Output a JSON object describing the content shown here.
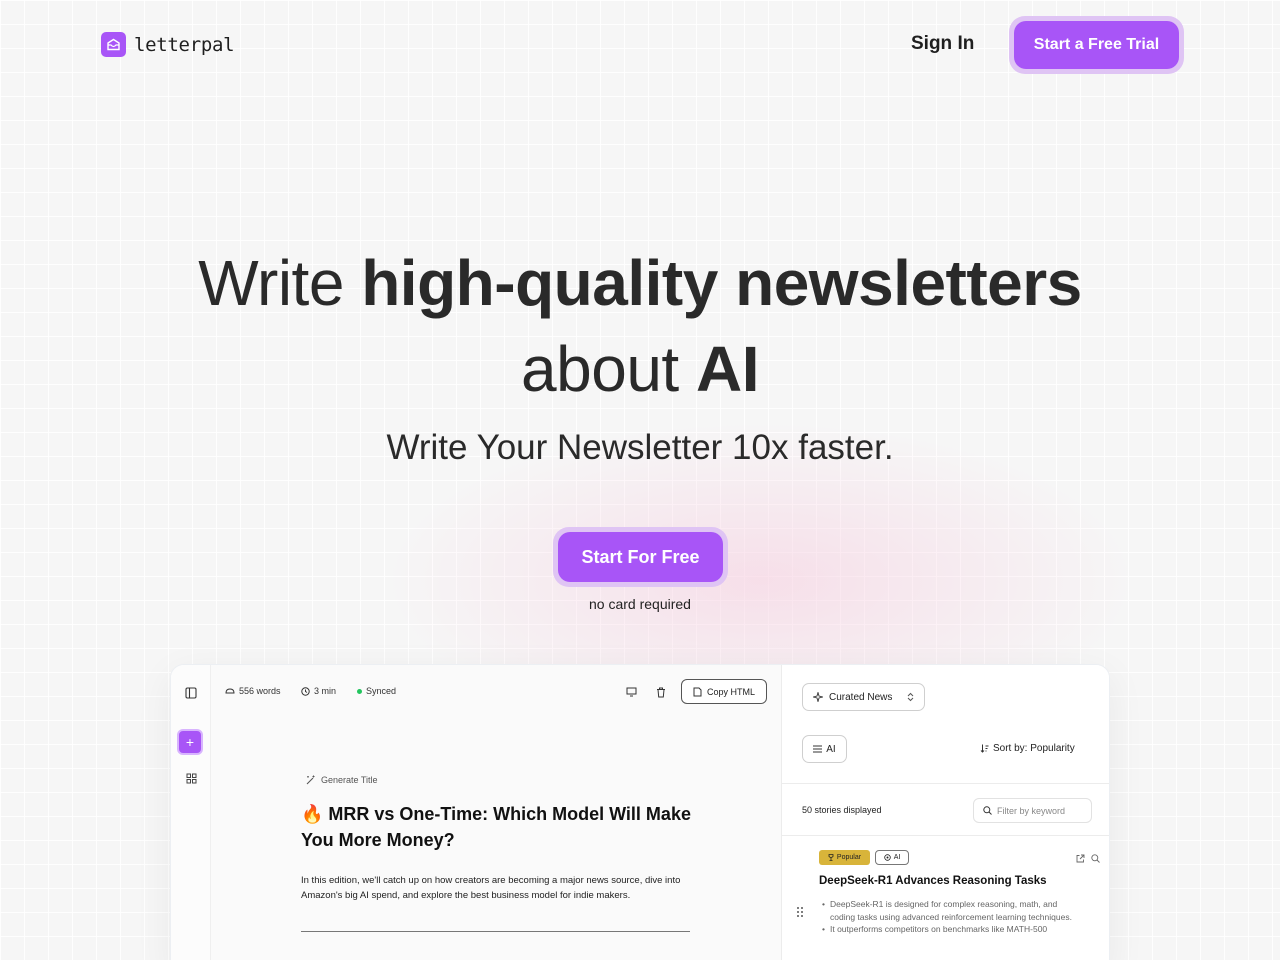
{
  "brand": {
    "name": "letterpal"
  },
  "nav": {
    "sign_in": "Sign In",
    "cta": "Start a Free Trial"
  },
  "hero": {
    "title_1": "Write ",
    "title_2": "high-quality newsletters",
    "title_3": "about ",
    "title_4": "AI",
    "subtitle": "Write Your Newsletter 10x faster.",
    "cta": "Start For Free",
    "note": "no card required"
  },
  "editor": {
    "words": "556 words",
    "read_time": "3 min",
    "sync_status": "Synced",
    "copy_html": "Copy HTML",
    "generate_title": "Generate Title",
    "doc_title": "🔥 MRR vs One-Time: Which Model Will Make You More Money?",
    "intro": "In this edition, we'll catch up on how creators are becoming a major news source, dive into Amazon's big AI spend, and explore the best business model for indie makers."
  },
  "panel": {
    "source": "Curated News",
    "tag": "AI",
    "sort": "Sort by: Popularity",
    "count": "50 stories displayed",
    "filter_placeholder": "Filter by keyword",
    "story": {
      "badge_popular": "Popular",
      "badge_ai": "AI",
      "title": "DeepSeek-R1 Advances Reasoning Tasks",
      "bullets": [
        "DeepSeek-R1 is designed for complex reasoning, math, and coding tasks using advanced reinforcement learning techniques.",
        "It outperforms competitors on benchmarks like MATH-500"
      ]
    }
  },
  "colors": {
    "accent": "#a855f7",
    "accent_ring": "#dfc4f4",
    "popular_badge": "#d8b43a",
    "sync_dot": "#22c55e"
  }
}
